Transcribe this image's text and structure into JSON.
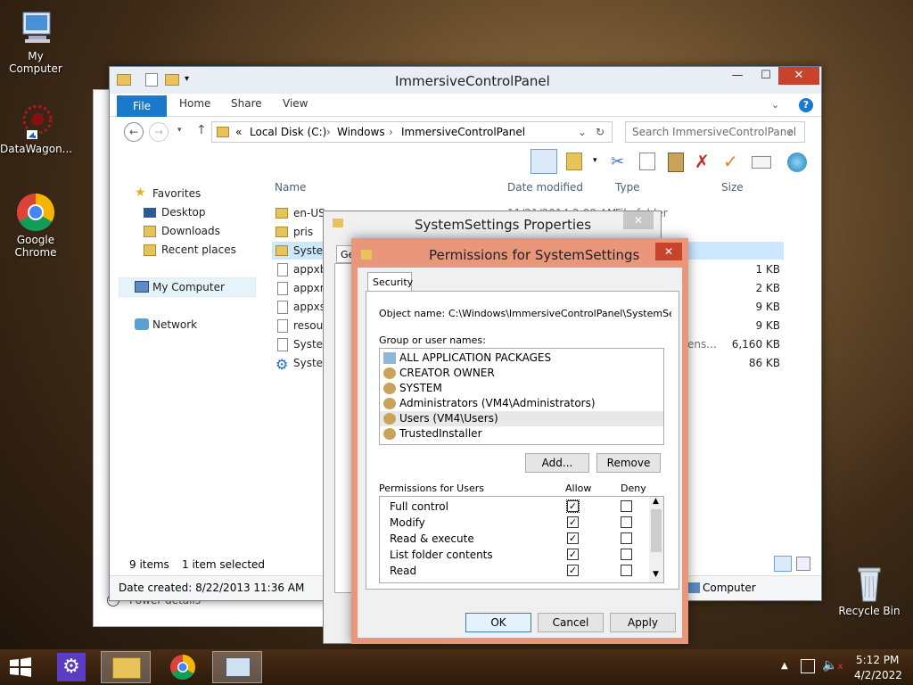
{
  "desktop": {
    "icons": [
      {
        "label": "My Computer"
      },
      {
        "label": "DataWagon..."
      },
      {
        "label": "Google Chrome"
      },
      {
        "label": "Recycle Bin"
      }
    ]
  },
  "explorer": {
    "title": "ImmersiveControlPanel",
    "ribbon_tabs": [
      "File",
      "Home",
      "Share",
      "View"
    ],
    "address": {
      "prefix": "«",
      "parts": [
        "Local Disk (C:)",
        "Windows",
        "ImmersiveControlPanel"
      ]
    },
    "search_placeholder": "Search ImmersiveControlPanel",
    "nav": {
      "favorites": "Favorites",
      "desktop": "Desktop",
      "downloads": "Downloads",
      "recent": "Recent places",
      "my_computer": "My Computer",
      "network": "Network"
    },
    "columns": {
      "name": "Name",
      "date": "Date modified",
      "type": "Type",
      "size": "Size"
    },
    "files": [
      {
        "name": "en-US",
        "date": "11/21/2014 2:08 AM",
        "type": "File folder",
        "size": ""
      },
      {
        "name": "pris",
        "date": "",
        "type": "",
        "size": ""
      },
      {
        "name": "Systen",
        "date": "",
        "type": "",
        "size": ""
      },
      {
        "name": "appxb",
        "date": "",
        "type": "",
        "size": "1 KB"
      },
      {
        "name": "appxm",
        "date": "",
        "type": "",
        "size": "2 KB"
      },
      {
        "name": "appxsi",
        "date": "",
        "type": "",
        "size": "9 KB"
      },
      {
        "name": "resour",
        "date": "",
        "type": "",
        "size": "9 KB"
      },
      {
        "name": "Systen",
        "date": "",
        "type": "ens...",
        "size": "6,160 KB"
      },
      {
        "name": "Systen",
        "date": "",
        "type": "",
        "size": "86 KB"
      }
    ],
    "status": {
      "items": "9 items",
      "selected": "1 item selected"
    },
    "details": {
      "date_created": "Date created: 8/22/2013 11:36 AM",
      "computer": "Computer"
    }
  },
  "back_window": {
    "text": "Power details"
  },
  "properties": {
    "title": "SystemSettings Properties",
    "tab": "Ge"
  },
  "permissions": {
    "title": "Permissions for SystemSettings",
    "tab": "Security",
    "object_label": "Object name:",
    "object_value": "C:\\Windows\\ImmersiveControlPanel\\SystemSettings",
    "group_label": "Group or user names:",
    "groups": [
      "ALL APPLICATION PACKAGES",
      "CREATOR OWNER",
      "SYSTEM",
      "Administrators (VM4\\Administrators)",
      "Users (VM4\\Users)",
      "TrustedInstaller"
    ],
    "add_label": "Add...",
    "remove_label": "Remove",
    "perm_header": "Permissions for Users",
    "allow_label": "Allow",
    "deny_label": "Deny",
    "perms": [
      {
        "name": "Full control",
        "allow": true,
        "deny": false
      },
      {
        "name": "Modify",
        "allow": true,
        "deny": false
      },
      {
        "name": "Read & execute",
        "allow": true,
        "deny": false
      },
      {
        "name": "List folder contents",
        "allow": true,
        "deny": false
      },
      {
        "name": "Read",
        "allow": true,
        "deny": false
      }
    ],
    "ok_label": "OK",
    "cancel_label": "Cancel",
    "apply_label": "Apply"
  },
  "taskbar": {
    "time": "5:12 PM",
    "date": "4/2/2022"
  }
}
